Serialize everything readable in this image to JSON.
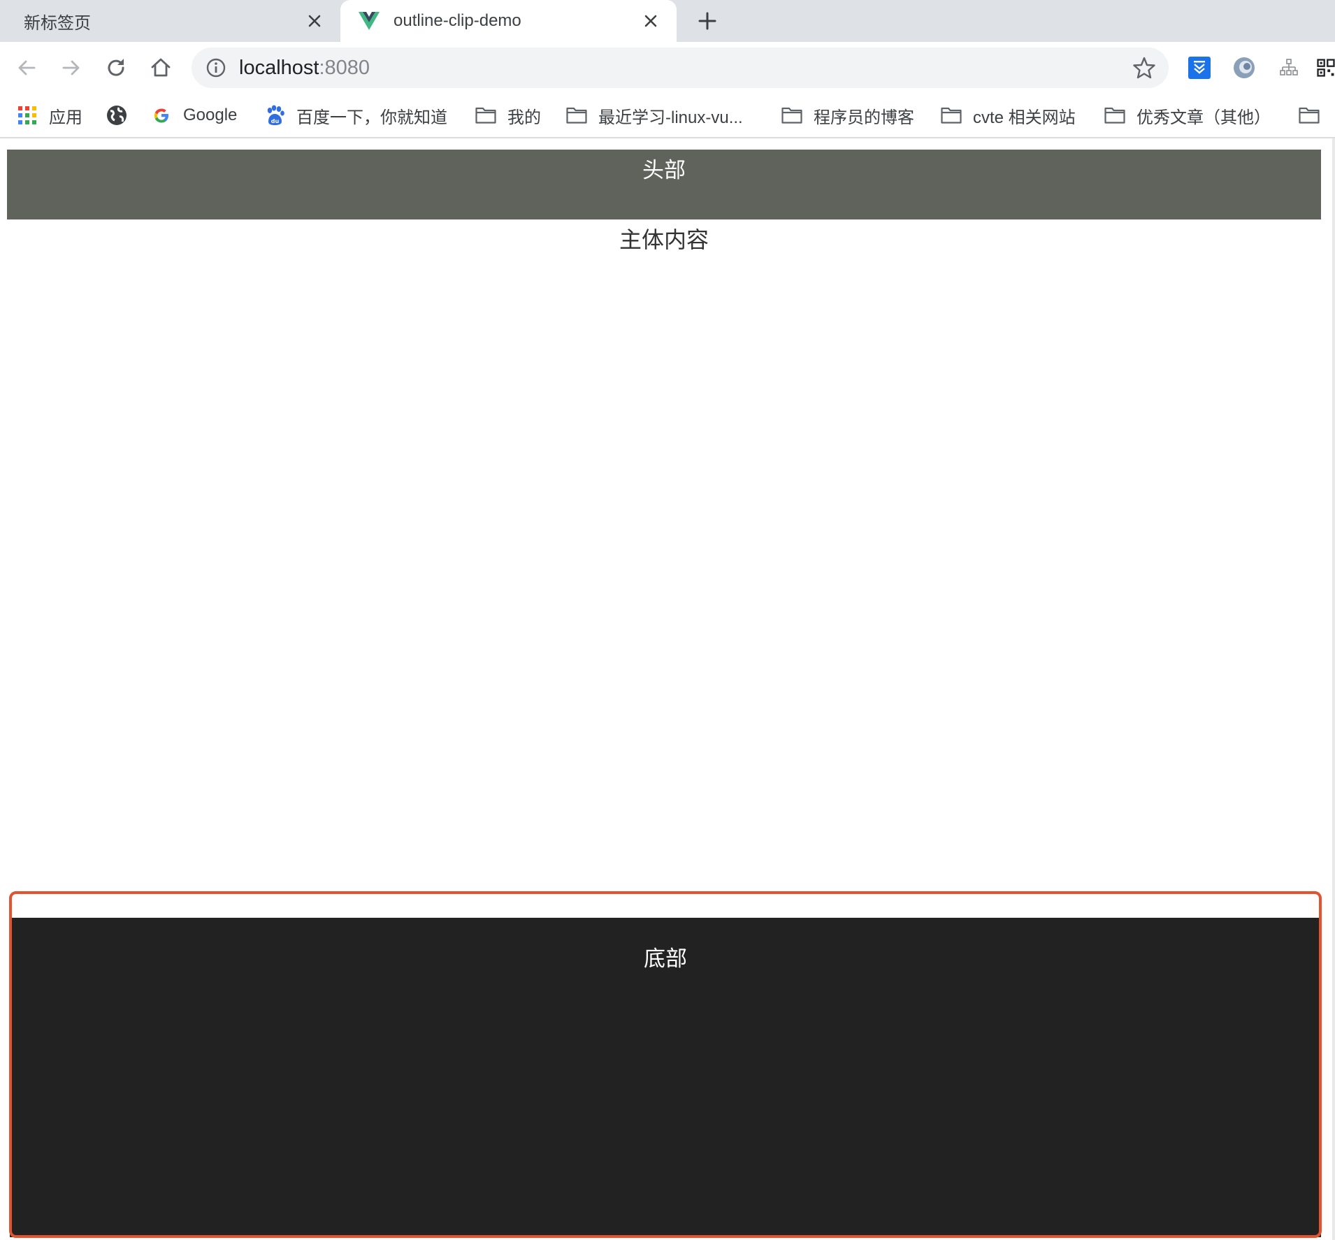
{
  "browser": {
    "tabs": [
      {
        "title": "新标签页",
        "active": false
      },
      {
        "title": "outline-clip-demo",
        "active": true,
        "favicon": "vue-logo-icon"
      }
    ],
    "address_bar": {
      "host": "localhost",
      "port": ":8080"
    },
    "bookmarks": [
      {
        "label": "应用",
        "icon": "apps-grid-icon"
      },
      {
        "label": "",
        "icon": "globe-icon"
      },
      {
        "label": "Google",
        "icon": "google-icon"
      },
      {
        "label": "百度一下，你就知道",
        "icon": "baidu-paw-icon"
      },
      {
        "label": "我的",
        "icon": "folder-icon"
      },
      {
        "label": "最近学习-linux-vu...",
        "icon": "folder-icon"
      },
      {
        "label": "程序员的博客",
        "icon": "folder-icon"
      },
      {
        "label": "cvte 相关网站",
        "icon": "folder-icon"
      },
      {
        "label": "优秀文章（其他）",
        "icon": "folder-icon"
      },
      {
        "label": "",
        "icon": "folder-icon"
      }
    ],
    "extensions": [
      "download-extension-icon",
      "circle-extension-icon",
      "sitemap-extension-icon",
      "qr-code-extension-icon"
    ]
  },
  "page": {
    "header_text": "头部",
    "main_text": "主体内容",
    "footer_text": "底部"
  },
  "colors": {
    "header_bg": "#5f635b",
    "footer_bg": "#232223",
    "outline": "#e1542f",
    "extension_blue": "#1a73e8"
  }
}
